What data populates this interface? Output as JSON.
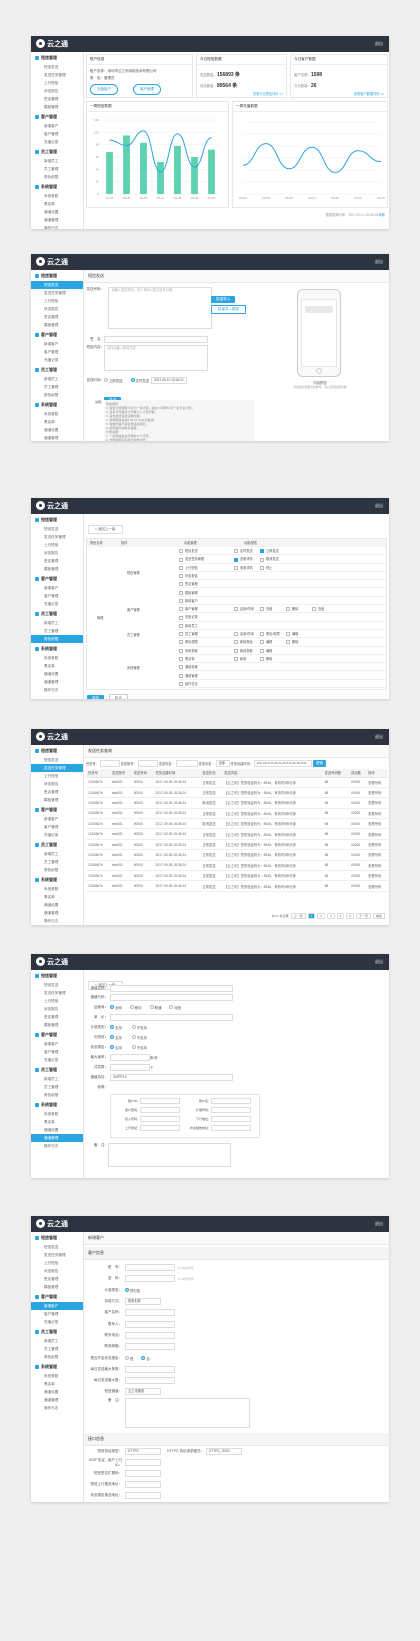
{
  "app": {
    "logo": "云之通",
    "exit": "退出"
  },
  "sidebar": [
    {
      "group": "短信管理",
      "items": [
        "短信发送",
        "发送任务管理",
        "上行短信",
        "状态报告",
        "签名管理",
        "模板管理"
      ]
    },
    {
      "group": "客户管理",
      "items": [
        "新增客户",
        "客户管理",
        "充值记录"
      ]
    },
    {
      "group": "员工管理",
      "items": [
        "新增员工",
        "员工管理",
        "角色权限"
      ]
    },
    {
      "group": "系统管理",
      "items": [
        "系统参数",
        "黑名单",
        "通道设置",
        "通道管理",
        "操作日志"
      ]
    }
  ],
  "s1": {
    "account_title": "账户信息",
    "user_label": "账户名称：",
    "user_name": "深圳市云之讯网络技术有限公司",
    "role_label": "角　色：",
    "role": "管理员",
    "btn1": "充值客户",
    "btn2": "客户管理",
    "today_title": "今日短信数据",
    "send_label": "发送数量：",
    "send_val": "156893 条",
    "ok_label": "成功数量：",
    "ok_val": "89564 条",
    "today_more": "查看今日短信详情 >>",
    "client_title": "今日客户数据",
    "total_label": "客户总数：",
    "total_val": "1598",
    "new_label": "今日新增：",
    "new_val": "26",
    "client_more": "查看客户数据详情 >>",
    "chart1_title": "一周短信数据",
    "chart2_title": "一周充值数据",
    "footer": "数据更新时间：2017-09-10 15:26:08",
    "refresh": "刷新"
  },
  "chart_data": [
    {
      "type": "bar",
      "title": "一周短信数据",
      "categories": [
        "09-04",
        "09-05",
        "09-06",
        "09-07",
        "09-08",
        "09-09",
        "09-10"
      ],
      "series": [
        {
          "name": "发送量",
          "values": [
            68,
            95,
            83,
            52,
            78,
            60,
            72
          ]
        }
      ],
      "ylim": [
        0,
        120
      ]
    },
    {
      "type": "line",
      "title": "一周充值数据",
      "categories": [
        "09-04",
        "09-05",
        "09-06",
        "09-07",
        "09-08",
        "09-09",
        "09-10"
      ],
      "series": [
        {
          "name": "充值金额",
          "values": [
            40,
            70,
            35,
            65,
            30,
            60,
            45
          ]
        }
      ]
    }
  ],
  "s2": {
    "title": "短信发送",
    "phone_label": "发送号码：",
    "phone_ph": "请输入发送号码，多个号码以英文逗号分隔",
    "import": "批量导入",
    "import_tpl": "批量导入模板",
    "sign_label": "签　名：",
    "content_label": "短信内容：",
    "content_ph": "请在此输入短信内容",
    "time_label": "发送时间：",
    "now": "立即发送",
    "timed": "定时发送",
    "time_val": "2017-09-10 15:26:21",
    "send": "发送",
    "preview": "内容预览",
    "preview_note": "手机展示效果仅供参考，请以实际接收为准",
    "note_title": "说明：",
    "notes": [
      "短信规则：",
      "1. 短信计费按照70字为一条计算，超过70字按67字一条分条计费；",
      "2. 签名与内容合计字数计入计费字数；",
      "3. 请勿发送违法违规内容；",
      "4. 营销短信请在8:00-21:00之间发送；",
      "5. 短信内容不得包含链接地址；",
      "6. 如有疑问请联系客服。",
      "计费说明：",
      "1. 一条短信最多可容纳70个字符；",
      "2. 长短信按实际拆分条数计费；",
      "3. 发送失败不扣费。"
    ]
  },
  "s3": {
    "back": "< 返回上一级",
    "h_name": "角色名称",
    "h_op": "操作",
    "h_mod": "功能管理",
    "h_perm": "功能权限",
    "role": "管理",
    "groups": [
      "短信管理",
      "客户管理",
      "员工管理",
      "系统管理"
    ],
    "mods": [
      "短信发送",
      "发送任务管理",
      "上行短信",
      "状态报告",
      "签名管理",
      "模板管理",
      "新增客户",
      "客户管理",
      "充值记录",
      "新增员工",
      "员工管理",
      "角色权限",
      "系统参数",
      "黑名单",
      "通道设置",
      "通道管理",
      "操作日志"
    ],
    "perms": [
      [
        "定时发送",
        "立即发送"
      ],
      [
        "查看详情",
        "取消发送"
      ],
      [
        "查看详情",
        "终止"
      ],
      [
        "",
        ""
      ],
      [
        "",
        ""
      ],
      [
        "",
        ""
      ],
      [
        "",
        ""
      ],
      [
        "启用/停用",
        "充值",
        "删除",
        "充值"
      ],
      [
        "",
        ""
      ],
      [
        "",
        ""
      ],
      [
        "启用/停用",
        "角色/权限",
        "编辑"
      ],
      [
        "新增角色",
        "编辑",
        "删除"
      ],
      [
        "新增参数",
        "编辑"
      ],
      [
        "新增",
        "删除"
      ],
      [
        "",
        ""
      ],
      [
        "",
        ""
      ],
      [
        "",
        ""
      ]
    ],
    "save": "保存",
    "cancel": "取消"
  },
  "s4": {
    "title": "发送任务查询",
    "f1": "任务号：",
    "f2": "发送账号：",
    "f3": "发送内容：",
    "f4": "发送状态：",
    "f4v": "全部",
    "f5": "任务创建时间：",
    "f5v": "2017-09-10 15:26:21~2017-10-01 16:21:02",
    "search": "搜索",
    "cols": [
      "任务号",
      "发送账号",
      "发送号码",
      "任务创建时间",
      "发送状态",
      "发送内容",
      "发送号码数",
      "成功数",
      "操作"
    ],
    "rows": [
      [
        "1234567b",
        "test001",
        "00000",
        "2017-09-05 15:36:24",
        "正常发送",
        "【云之讯】您的验证码为：8546，有效时间5分钟",
        "68",
        "00000",
        "查看号码"
      ],
      [
        "1234567b",
        "test001",
        "00000",
        "2017-09-05 15:36:24",
        "正常发送",
        "【云之讯】您的验证码为：8546，有效时间5分钟",
        "68",
        "00000",
        "查看号码"
      ],
      [
        "1234567b",
        "test001",
        "00000",
        "2017-09-05 15:36:24",
        "取消发送",
        "【云之讯】您的验证码为：8546，有效时间5分钟",
        "68",
        "00000",
        "查看号码"
      ],
      [
        "1234567b",
        "test001",
        "00000",
        "2017-09-05 15:36:24",
        "正常发送",
        "【云之讯】您的验证码为：8546，有效时间5分钟",
        "68",
        "00000",
        "查看号码"
      ],
      [
        "1234567b",
        "test001",
        "00000",
        "2017-09-05 15:36:24",
        "取消发送",
        "【云之讯】您的验证码为：8546，有效时间5分钟",
        "68",
        "00000",
        "查看号码"
      ],
      [
        "1234567b",
        "test001",
        "00000",
        "2017-09-05 15:36:24",
        "正常发送",
        "【云之讯】您的验证码为：8546，有效时间5分钟",
        "68",
        "00000",
        "查看号码"
      ],
      [
        "1234567b",
        "test001",
        "00000",
        "2017-09-05 15:36:24",
        "正常发送",
        "【云之讯】您的验证码为：8546，有效时间5分钟",
        "68",
        "00000",
        "查看号码"
      ],
      [
        "1234567b",
        "test001",
        "00000",
        "2017-09-05 15:36:24",
        "正常发送",
        "【云之讯】您的验证码为：8546，有效时间5分钟",
        "68",
        "00000",
        "查看号码"
      ],
      [
        "1234567b",
        "test001",
        "00000",
        "2017-09-05 15:36:24",
        "正常发送",
        "【云之讯】您的验证码为：8546，有效时间5分钟",
        "68",
        "00000",
        "查看号码"
      ],
      [
        "1234567b",
        "test001",
        "00000",
        "2017-09-05 15:36:24",
        "正常发送",
        "【云之讯】您的验证码为：8546，有效时间5分钟",
        "68",
        "00000",
        "查看号码"
      ],
      [
        "1234567b",
        "test001",
        "00000",
        "2017-09-05 15:36:24",
        "正常发送",
        "【云之讯】您的验证码为：8546，有效时间5分钟",
        "68",
        "00000",
        "查看号码"
      ]
    ],
    "pager": [
      "共 87 条记录",
      "上一页",
      "1",
      "2",
      "3",
      "4",
      "5",
      "下一页",
      "前往"
    ]
  },
  "s5": {
    "back": "< 返回上一级",
    "fields": [
      "通道名称：",
      "通道代码：",
      "运营商：",
      "单　价：",
      "计费规则：",
      "长短信：",
      "状态报告：",
      "最大速率：",
      "并发数：",
      "通道协议：",
      "参数："
    ],
    "op": [
      "全网",
      "移动",
      "联通",
      "电信"
    ],
    "yes": "支持",
    "no": "不支持",
    "unit": "条/秒",
    "unit2": "个",
    "protocol": "CMPP3.0",
    "params": [
      "账户ID：",
      "账户名：",
      "账户密码：",
      "扩展号码：",
      "接入号码：",
      "下行地址：",
      "上行地址：",
      "状态报告地址："
    ],
    "remark": "备　注：",
    "save": "保存",
    "cancel": "取消"
  },
  "s6": {
    "title": "新增客户",
    "sec1": "客户信息",
    "fields": [
      "账　号：",
      "密　码：",
      "计费类型：",
      "扣费方式：",
      "客户名称：",
      "联系人：",
      "联系电话：",
      "联系邮箱：",
      "是否开启状态报告：",
      "每日发送最大条数：",
      "每日发送最大数：",
      "短信通道：",
      "备　注："
    ],
    "tip1": "6~16位字符",
    "billing": "预付费",
    "pay": "按条扣费",
    "channel": "云之讯通道",
    "sec2": "接口信息",
    "api": [
      "短信协议类型：",
      "SGIP 协议 - 客户上行ID：",
      "短信签名扩展码：",
      "短信上行推送地址：",
      "状态报告推送地址："
    ],
    "api_v1": "HTTPS",
    "api_l2": "HTTPS 协议请求格式：",
    "api_v2": "HTTPS_JSON",
    "save": "保存",
    "cancel": "取消"
  },
  "colors": {
    "accent": "#2aa5e0",
    "header": "#2d3440",
    "bar": "#5ed1b0",
    "line": "#2aa5e0"
  }
}
